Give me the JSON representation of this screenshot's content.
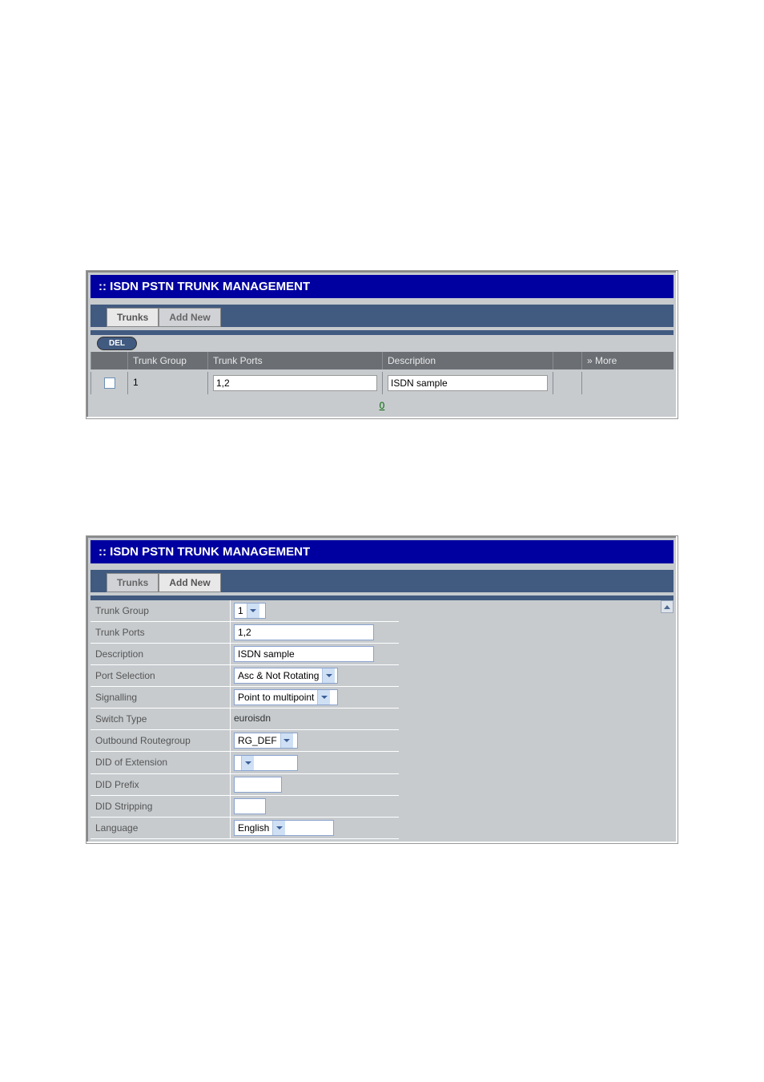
{
  "panel1": {
    "title": ":: ISDN PSTN TRUNK MANAGEMENT",
    "tabs": [
      "Trunks",
      "Add New"
    ],
    "del_label": "DEL",
    "columns": {
      "group": "Trunk Group",
      "ports": "Trunk Ports",
      "desc": "Description",
      "more": "More"
    },
    "rows": [
      {
        "group": "1",
        "ports": "1,2",
        "desc": "ISDN sample"
      }
    ],
    "page": "0"
  },
  "panel2": {
    "title": ":: ISDN PSTN TRUNK MANAGEMENT",
    "tabs": [
      "Trunks",
      "Add New"
    ],
    "fields": {
      "trunk_group": {
        "label": "Trunk Group",
        "value": "1"
      },
      "trunk_ports": {
        "label": "Trunk Ports",
        "value": "1,2"
      },
      "description": {
        "label": "Description",
        "value": "ISDN sample"
      },
      "port_selection": {
        "label": "Port Selection",
        "value": "Asc & Not Rotating"
      },
      "signalling": {
        "label": "Signalling",
        "value": "Point to multipoint"
      },
      "switch_type": {
        "label": "Switch Type",
        "value": "euroisdn"
      },
      "outbound_routegroup": {
        "label": "Outbound Routegroup",
        "value": "RG_DEF"
      },
      "did_of_extension": {
        "label": "DID of Extension",
        "value": ""
      },
      "did_prefix": {
        "label": "DID Prefix",
        "value": ""
      },
      "did_stripping": {
        "label": "DID Stripping",
        "value": ""
      },
      "language": {
        "label": "Language",
        "value": "English"
      }
    }
  }
}
